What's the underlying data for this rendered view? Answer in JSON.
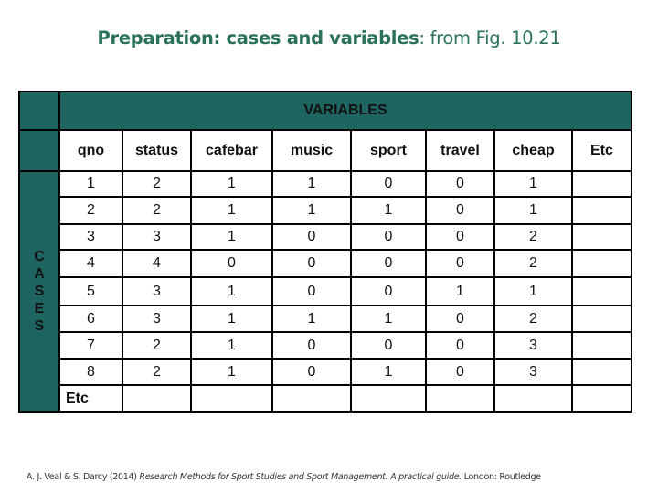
{
  "title": {
    "bold_part": "Preparation: cases and variables",
    "rest_part": ": from Fig. 10.21"
  },
  "table": {
    "variables_label": "VARIABLES",
    "cases_label": [
      "C",
      "A",
      "S",
      "E",
      "S"
    ],
    "columns": [
      "qno",
      "status",
      "cafebar",
      "music",
      "sport",
      "travel",
      "cheap",
      "Etc"
    ],
    "rows": [
      [
        "1",
        "2",
        "1",
        "1",
        "0",
        "0",
        "1",
        ""
      ],
      [
        "2",
        "2",
        "1",
        "1",
        "1",
        "0",
        "1",
        ""
      ],
      [
        "3",
        "3",
        "1",
        "0",
        "0",
        "0",
        "2",
        ""
      ],
      [
        "4",
        "4",
        "0",
        "0",
        "0",
        "0",
        "2",
        ""
      ],
      [
        "5",
        "3",
        "1",
        "0",
        "0",
        "1",
        "1",
        ""
      ],
      [
        "6",
        "3",
        "1",
        "1",
        "1",
        "0",
        "2",
        ""
      ],
      [
        "7",
        "2",
        "1",
        "0",
        "0",
        "0",
        "3",
        ""
      ],
      [
        "8",
        "2",
        "1",
        "0",
        "1",
        "0",
        "3",
        ""
      ]
    ],
    "etc_row_label": "Etc",
    "header_color": "#1e6460"
  },
  "citation": {
    "authors": "A. J. Veal & S. Darcy (2014) ",
    "book_title": "Research Methods for Sport Studies and Sport Management: A practical guide.",
    "publisher": " London: Routledge"
  }
}
